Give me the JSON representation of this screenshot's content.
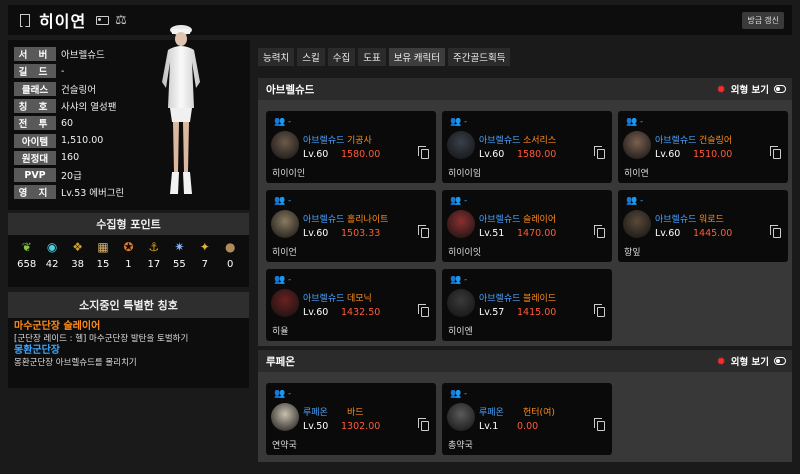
{
  "header": {
    "name": "히이연",
    "refresh_label": "방금 갱신"
  },
  "profile": {
    "rows": [
      {
        "label": "서 버",
        "value": "아브렐슈드"
      },
      {
        "label": "길 드",
        "value": "-"
      },
      {
        "label": "클래스",
        "value": "건슬링어"
      },
      {
        "label": "칭 호",
        "value": "사샤의 열성팬"
      },
      {
        "label": "전 투",
        "value": "60"
      },
      {
        "label": "아이템",
        "value": "1,510.00"
      },
      {
        "label": "원정대",
        "value": "160"
      },
      {
        "label": "PVP",
        "value": "20급"
      },
      {
        "label": "영 지",
        "value": "Lv.53 에버그린"
      }
    ]
  },
  "points": {
    "title": "수집형 포인트",
    "items": [
      {
        "icon": "mokoko-seed-icon",
        "value": "658"
      },
      {
        "icon": "island-heart-icon",
        "value": "42"
      },
      {
        "icon": "giant-heart-icon",
        "value": "38"
      },
      {
        "icon": "art-icon",
        "value": "15"
      },
      {
        "icon": "ignea-token-icon",
        "value": "1"
      },
      {
        "icon": "voyage-icon",
        "value": "17"
      },
      {
        "icon": "world-tree-leaf-icon",
        "value": "55"
      },
      {
        "icon": "orpheus-star-icon",
        "value": "7"
      },
      {
        "icon": "medal-icon",
        "value": "0"
      }
    ]
  },
  "titles": {
    "title": "소지중인 특별한 칭호",
    "items": [
      {
        "name": "마수군단장 술레이어",
        "desc": "[군단장 레이드 : 헬] 마수군단장 발탄을 토벌하기",
        "color": "orange"
      },
      {
        "name": "몽환군단장",
        "desc": "몽환군단장 아브렐슈드를 몰리치기",
        "color": "blue"
      }
    ]
  },
  "tabs": [
    "능력치",
    "스킬",
    "수집",
    "도표",
    "보유 캐릭터",
    "주간골드획득"
  ],
  "look_label": "외형 보기",
  "sections": [
    {
      "title": "아브렐슈드",
      "cards": [
        {
          "dash": "-",
          "server": "아브렐슈드",
          "class": "기공사",
          "level": "Lv.60",
          "ilvl": "1580.00",
          "name": "히이이인"
        },
        {
          "dash": "-",
          "server": "아브렐슈드",
          "class": "소서리스",
          "level": "Lv.60",
          "ilvl": "1580.00",
          "name": "히이이임"
        },
        {
          "dash": "-",
          "server": "아브렐슈드",
          "class": "건슬링어",
          "level": "Lv.60",
          "ilvl": "1510.00",
          "name": "히이연"
        },
        {
          "dash": "-",
          "server": "아브렐슈드",
          "class": "홀리나이트",
          "level": "Lv.60",
          "ilvl": "1503.33",
          "name": "히이언"
        },
        {
          "dash": "-",
          "server": "아브렐슈드",
          "class": "슬레이어",
          "level": "Lv.51",
          "ilvl": "1470.00",
          "name": "히이이잇"
        },
        {
          "dash": "-",
          "server": "아브렐슈드",
          "class": "워로드",
          "level": "Lv.60",
          "ilvl": "1445.00",
          "name": "항잎"
        },
        {
          "dash": "-",
          "server": "아브렐슈드",
          "class": "데모닉",
          "level": "Lv.60",
          "ilvl": "1432.50",
          "name": "히율"
        },
        {
          "dash": "-",
          "server": "아브렐슈드",
          "class": "블레이드",
          "level": "Lv.57",
          "ilvl": "1415.00",
          "name": "히이엔"
        }
      ]
    },
    {
      "title": "루페온",
      "cards": [
        {
          "dash": "-",
          "server": "루페온",
          "class": "바드",
          "level": "Lv.50",
          "ilvl": "1302.00",
          "name": "연약국"
        },
        {
          "dash": "-",
          "server": "루페온",
          "class": "헌터(여)",
          "level": "Lv.1",
          "ilvl": "0.00",
          "name": "총약국"
        }
      ]
    }
  ]
}
